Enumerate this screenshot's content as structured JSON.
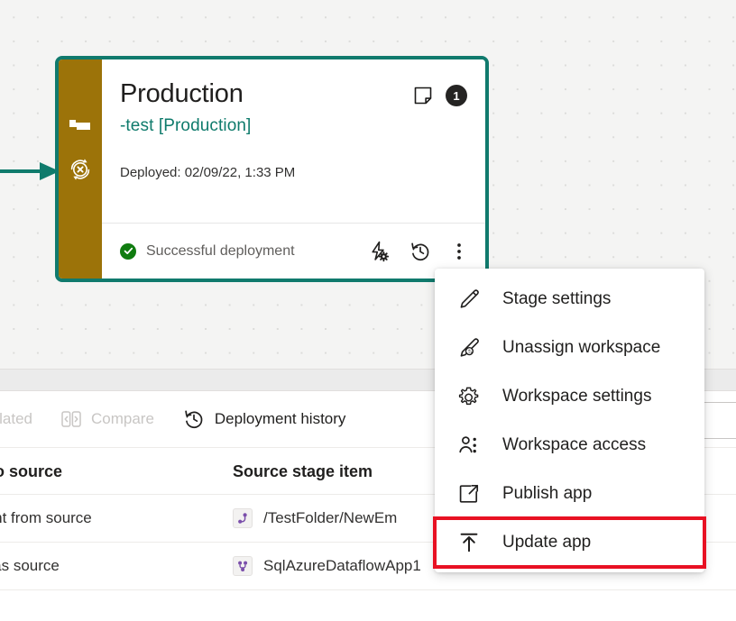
{
  "canvas": {
    "background_color": "#f4f4f3",
    "grid_dot_color": "#dcdcda"
  },
  "stage_card": {
    "border_color": "#107a6d",
    "rail_color": "#9c7309",
    "title": "Production",
    "subtitle": "-test [Production]",
    "subtitle_color": "#0f7b6c",
    "deployed_text": "Deployed: 02/09/22, 1:33 PM",
    "badge_count": "1",
    "badge_color": "#252423",
    "note_icon": "sticky-note-icon",
    "rail_icons": [
      "flag-icon",
      "sync-error-icon"
    ],
    "status": {
      "label": "Successful deployment",
      "icon": "check-circle-icon",
      "icon_color": "#107c10",
      "text_color": "#605e5c"
    },
    "footer_actions": [
      {
        "name": "deployment-rules-icon",
        "title": "Deployment rules"
      },
      {
        "name": "deployment-history-icon",
        "title": "Deployment history"
      },
      {
        "name": "more-options-icon",
        "title": "More options"
      }
    ],
    "incoming_arrow_color": "#0f7b6c"
  },
  "context_menu": {
    "items": [
      {
        "label": "Stage settings",
        "icon": "pencil-icon"
      },
      {
        "label": "Unassign workspace",
        "icon": "pencil-unassign-icon"
      },
      {
        "label": "Workspace settings",
        "icon": "gear-icon"
      },
      {
        "label": "Workspace access",
        "icon": "people-icon"
      },
      {
        "label": "Publish app",
        "icon": "open-in-new-icon"
      },
      {
        "label": "Update app",
        "icon": "upload-icon",
        "highlighted": true
      }
    ],
    "highlight_color": "#e81123"
  },
  "command_bar": {
    "items": [
      {
        "label": "related",
        "icon": "related-icon",
        "enabled": false,
        "clipped": true
      },
      {
        "label": "Compare",
        "icon": "compare-icon",
        "enabled": false
      },
      {
        "label": "Deployment history",
        "icon": "deployment-history-icon",
        "enabled": true
      }
    ],
    "search_box": {
      "name": "search-input",
      "value": "",
      "placeholder": ""
    }
  },
  "table": {
    "headers": [
      "l to source",
      "Source stage item"
    ],
    "rows": [
      {
        "compare": "rent from source",
        "item": "/TestFolder/NewEm",
        "icon": "dataflow-icon"
      },
      {
        "compare": "e as source",
        "item": "SqlAzureDataflowApp1",
        "icon": "dataflow-icon"
      }
    ]
  }
}
